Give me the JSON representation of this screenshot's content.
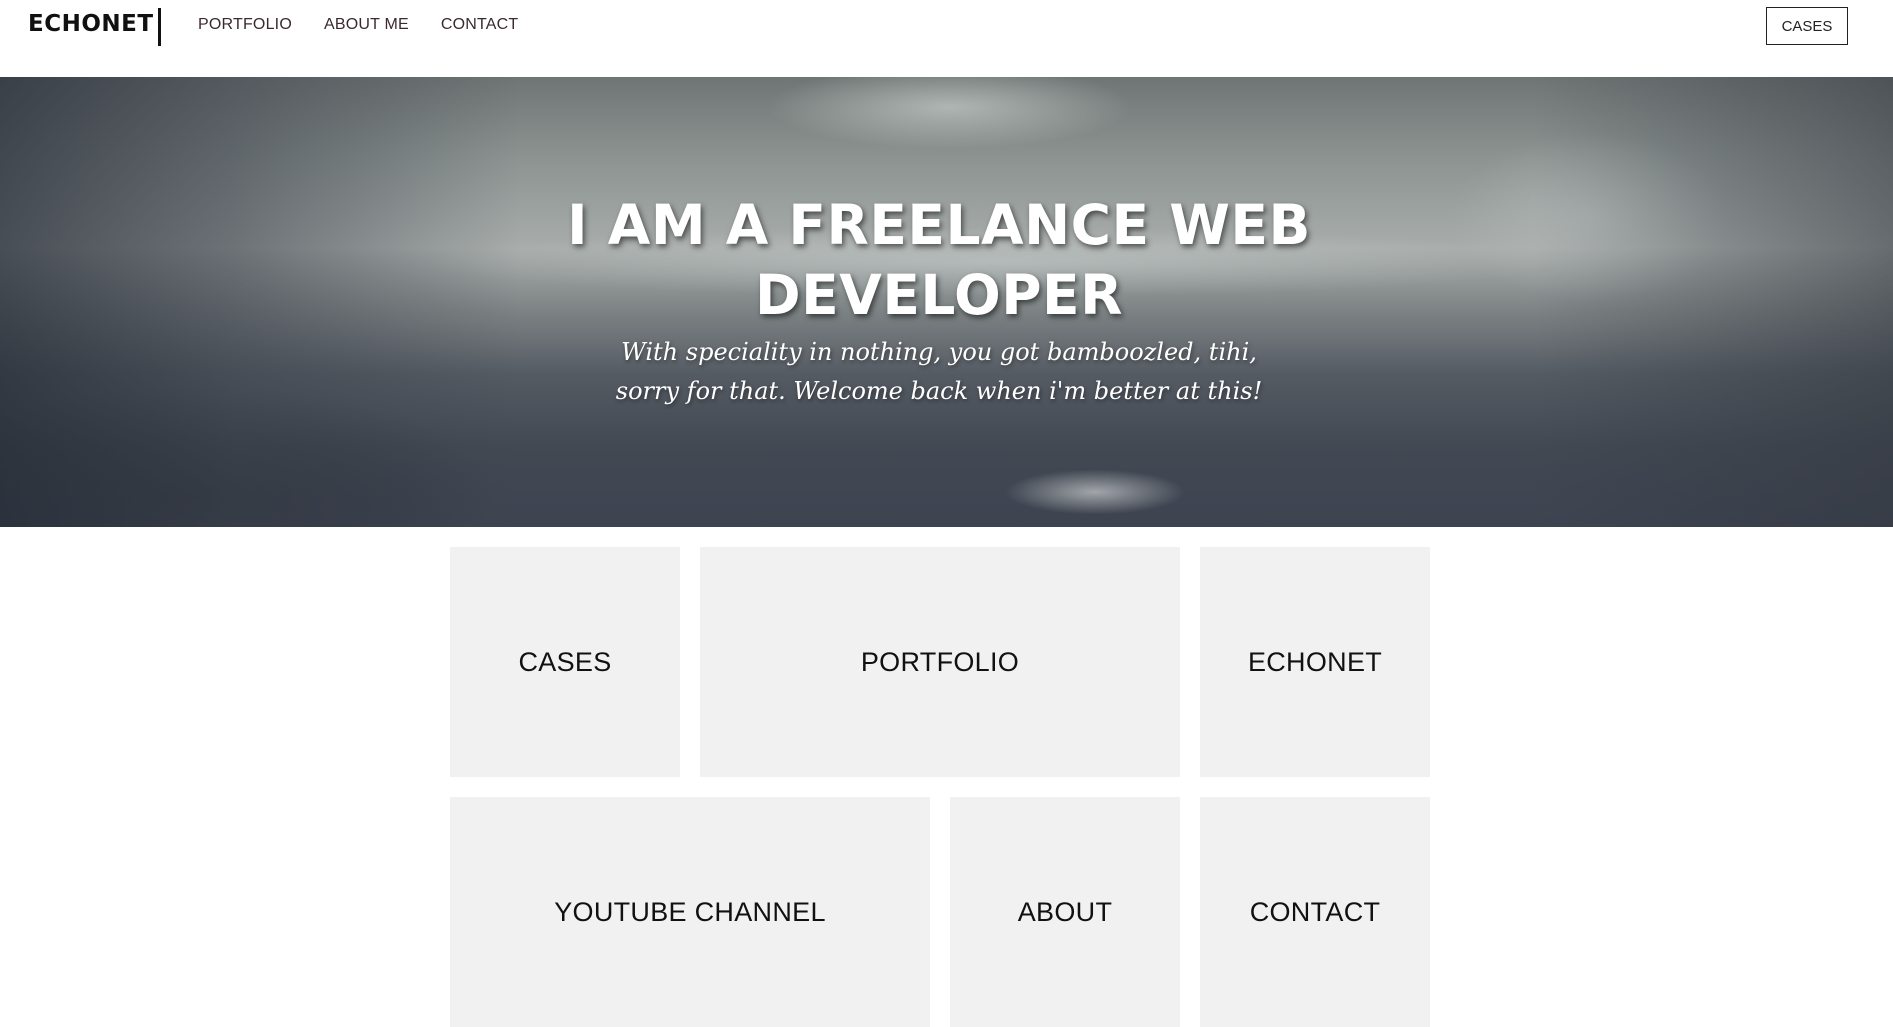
{
  "header": {
    "brand": "ECHONET",
    "nav": [
      "PORTFOLIO",
      "ABOUT ME",
      "CONTACT"
    ],
    "cta_label": "CASES"
  },
  "hero": {
    "title_line1": "I AM A FREELANCE WEB",
    "title_line2": "DEVELOPER",
    "subtitle_line1": "With speciality in nothing, you got bamboozled, tihi,",
    "subtitle_line2": "sorry for that. Welcome back when i'm better at this!"
  },
  "tiles": [
    {
      "label": "CASES"
    },
    {
      "label": "PORTFOLIO"
    },
    {
      "label": "ECHONET"
    },
    {
      "label": "YOUTUBE CHANNEL"
    },
    {
      "label": "ABOUT"
    },
    {
      "label": "CONTACT"
    }
  ],
  "colors": {
    "text": "#111111",
    "tile_background": "#f1f1f1",
    "hero_text": "#ffffff"
  }
}
